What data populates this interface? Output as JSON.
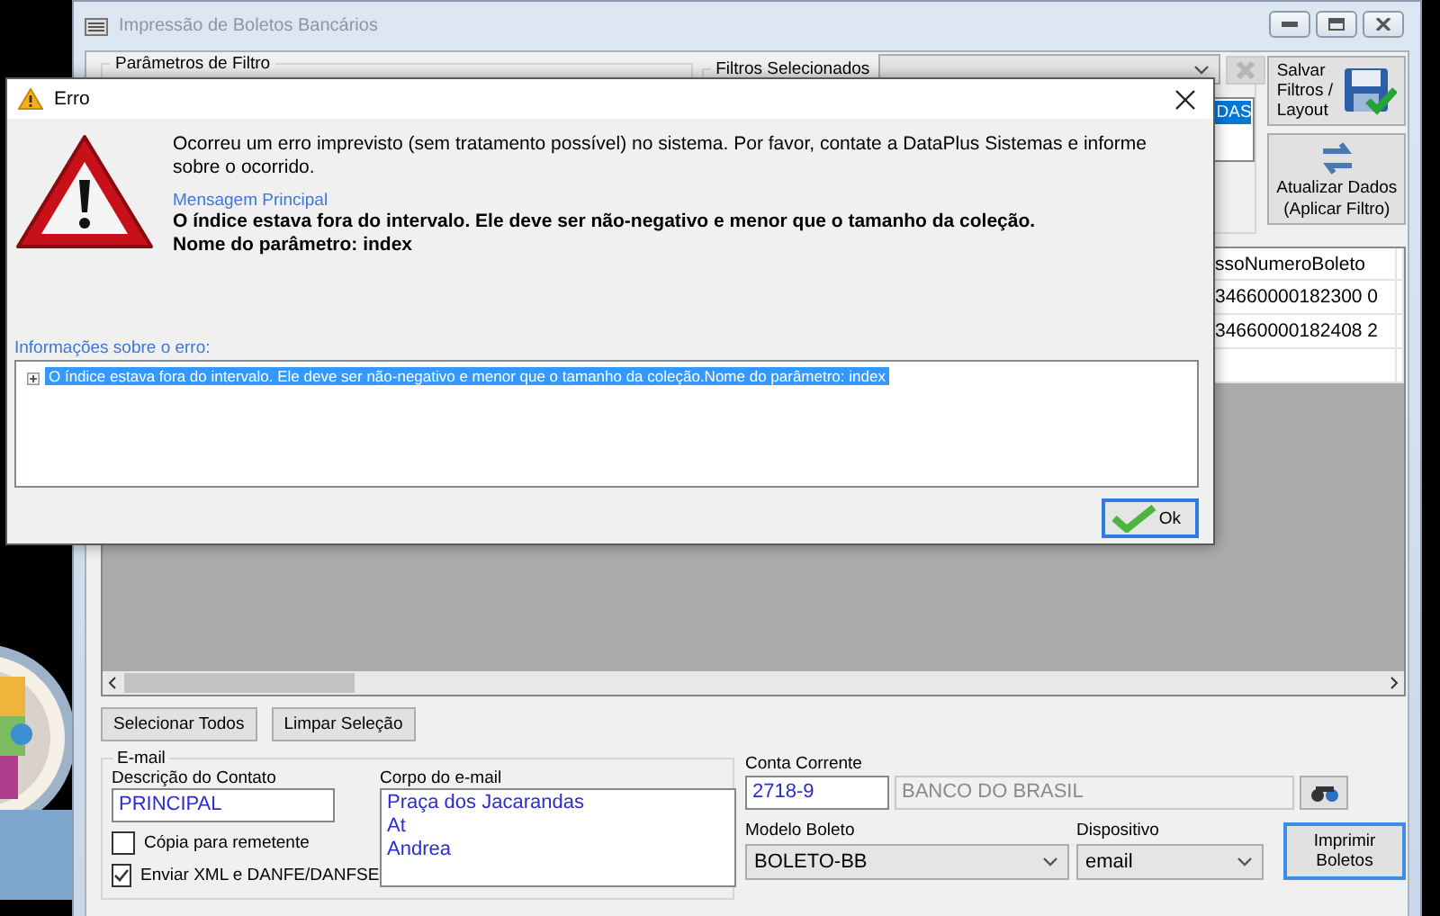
{
  "main_window": {
    "title": "Impressão de Boletos Bancários",
    "filter_group": {
      "label": "Parâmetros de Filtro"
    },
    "selected_filters": {
      "label": "Filtros Selecionados",
      "list_items": [
        {
          "text": "DAS",
          "selected": true
        }
      ]
    },
    "side_buttons": [
      {
        "kind": "save",
        "label": "Salvar Filtros / Layout"
      },
      {
        "kind": "refresh",
        "label": "Atualizar Dados (Aplicar Filtro)"
      }
    ],
    "grid": {
      "columns": [
        "ssoNumeroBoleto"
      ],
      "rows": [
        [
          "34660000182300 0"
        ],
        [
          "34660000182408 2"
        ]
      ]
    },
    "selection_buttons": [
      "Selecionar Todos",
      "Limpar Seleção"
    ],
    "email": {
      "title": "E-mail",
      "contact_label": "Descrição do Contato",
      "contact_value": "PRINCIPAL",
      "options": [
        {
          "label": "Cópia para remetente",
          "checked": false
        },
        {
          "label": "Enviar XML e DANFE/DANFSE",
          "checked": true
        }
      ],
      "body_label": "Corpo do e-mail",
      "body_lines": [
        "Praça dos Jacarandas",
        "At",
        "Andrea"
      ]
    },
    "account": {
      "label": "Conta Corrente",
      "value": "2718-9",
      "bank": "BANCO DO BRASIL"
    },
    "model": {
      "label": "Modelo Boleto",
      "value": "BOLETO-BB"
    },
    "device": {
      "label": "Dispositivo",
      "value": "email"
    },
    "print_button": "Imprimir Boletos"
  },
  "error_dialog": {
    "title": "Erro",
    "message": "Ocorreu um erro imprevisto (sem tratamento possível) no sistema. Por favor, contate a DataPlus Sistemas e informe sobre o ocorrido.",
    "main_label": "Mensagem Principal",
    "main_lines": [
      "O índice estava fora do intervalo. Ele deve ser não-negativo e menor que o tamanho da coleção.",
      "Nome do parâmetro: index"
    ],
    "details_label": "Informações sobre o erro:",
    "details": [
      {
        "text": "O índice estava fora do intervalo. Ele deve ser não-negativo e menor que o tamanho da coleção.Nome do parâmetro: index",
        "selected": true,
        "expanded": false
      }
    ],
    "ok_button": "Ok"
  }
}
